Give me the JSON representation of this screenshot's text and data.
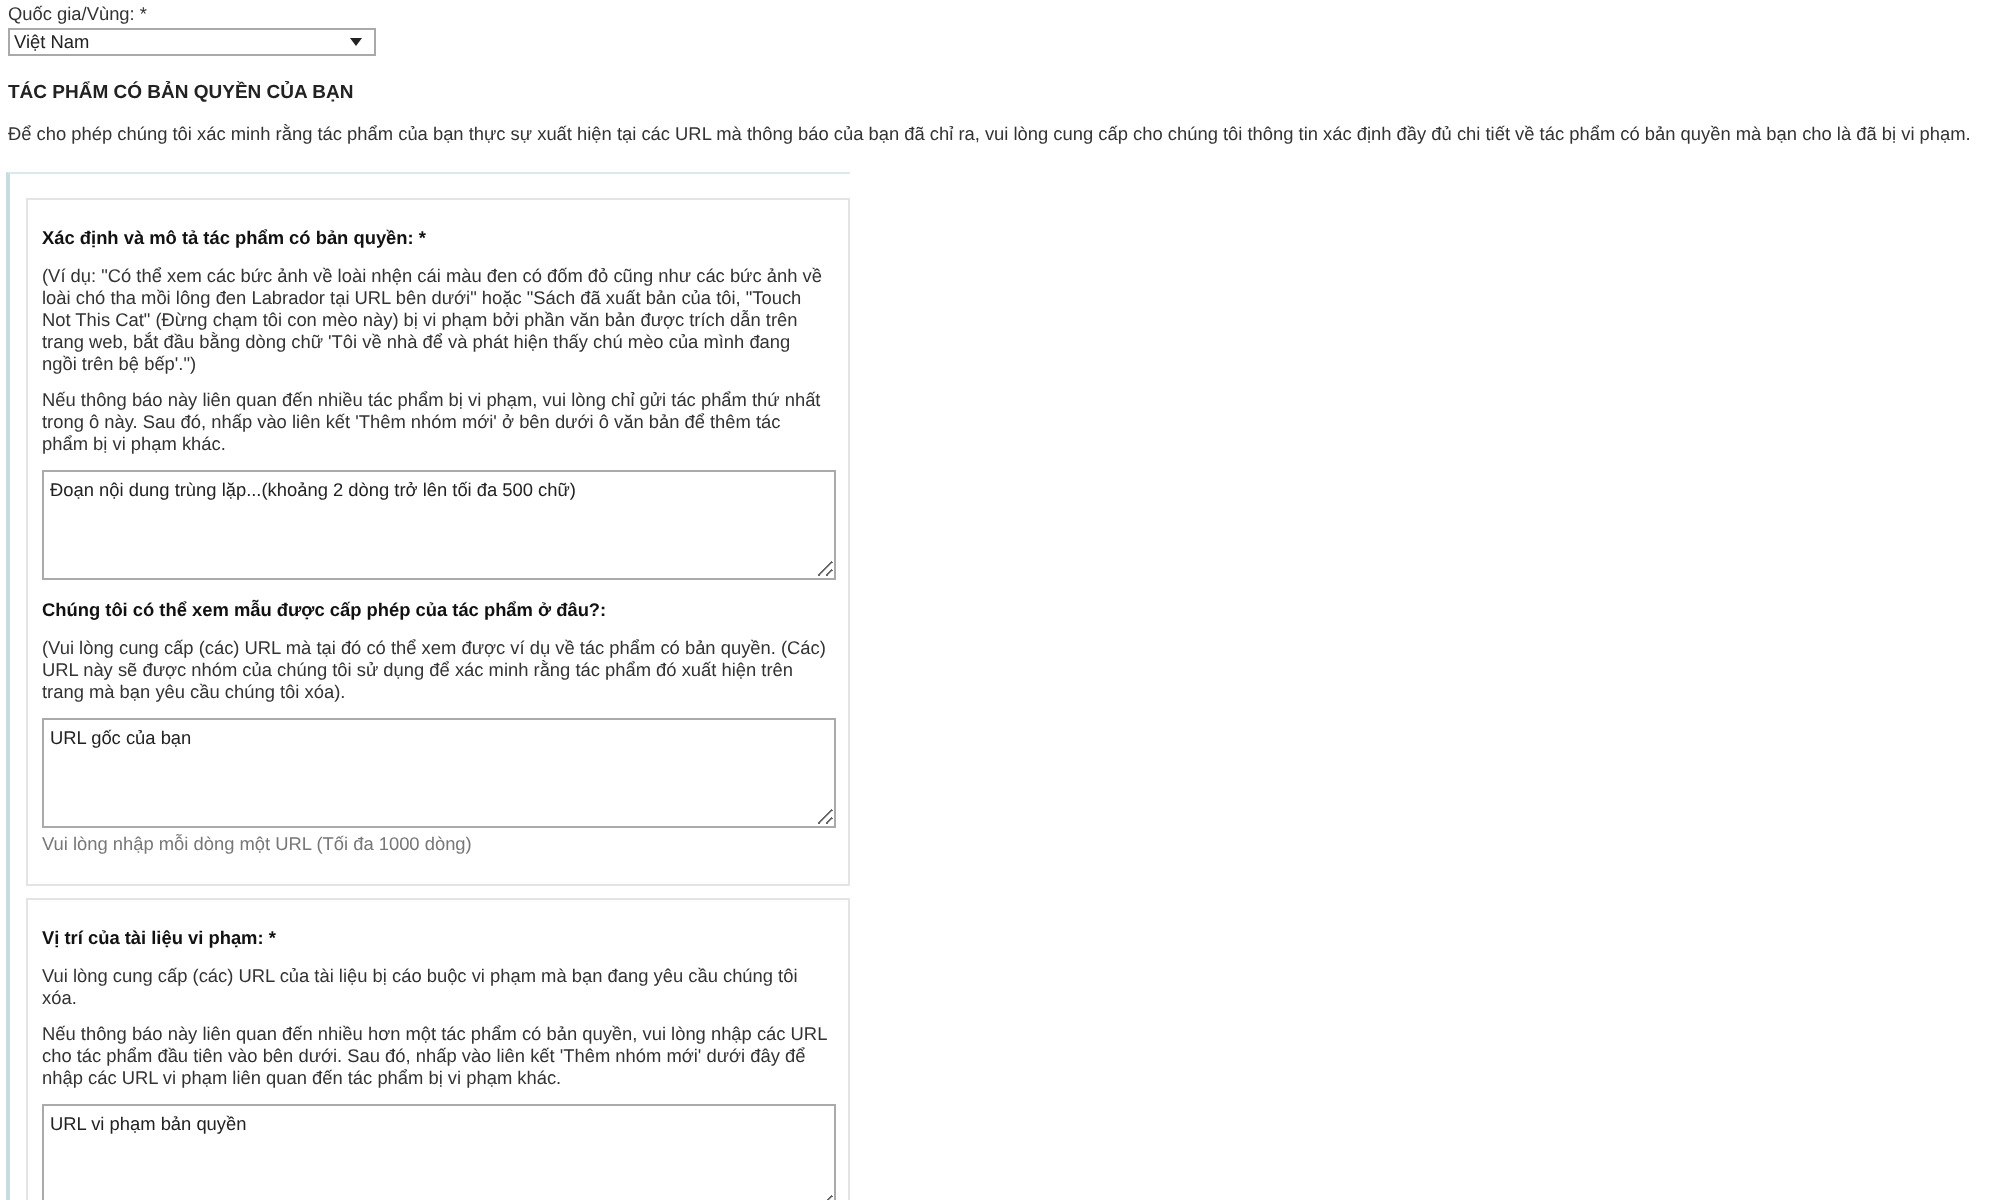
{
  "country_field": {
    "label": "Quốc gia/Vùng: *",
    "value": "Việt Nam"
  },
  "section": {
    "heading": "TÁC PHẨM CÓ BẢN QUYỀN CỦA BẠN",
    "intro": "Để cho phép chúng tôi xác minh rằng tác phẩm của bạn thực sự xuất hiện tại các URL mà thông báo của bạn đã chỉ ra, vui lòng cung cấp cho chúng tôi thông tin xác định đầy đủ chi tiết về tác phẩm có bản quyền mà bạn cho là đã bị vi phạm."
  },
  "groups": [
    {
      "questions": [
        {
          "label": "Xác định và mô tả tác phẩm có bản quyền: *",
          "paragraphs": [
            "(Ví dụ: \"Có thể xem các bức ảnh về loài nhện cái màu đen có đốm đỏ cũng như các bức ảnh về loài chó tha mồi lông đen Labrador tại URL bên dưới\" hoặc \"Sách đã xuất bản của tôi, \"Touch Not This Cat\" (Đừng chạm tôi con mèo này) bị vi phạm bởi phần văn bản được trích dẫn trên trang web, bắt đầu bằng dòng chữ 'Tôi về nhà để và phát hiện thấy chú mèo của mình đang ngồi trên bệ bếp'.\")",
            "Nếu thông báo này liên quan đến nhiều tác phẩm bị vi phạm, vui lòng chỉ gửi tác phẩm thứ nhất trong ô này. Sau đó, nhấp vào liên kết 'Thêm nhóm mới' ở bên dưới ô văn bản để thêm tác phẩm bị vi phạm khác."
          ],
          "value": "Đoạn nội dung trùng lặp...(khoảng 2 dòng trở lên tối đa 500 chữ)"
        },
        {
          "label": "Chúng tôi có thể xem mẫu được cấp phép của tác phẩm ở đâu?:",
          "paragraphs": [
            "(Vui lòng cung cấp (các) URL mà tại đó có thể xem được ví dụ về tác phẩm có bản quyền. (Các) URL này sẽ được nhóm của chúng tôi sử dụng để xác minh rằng tác phẩm đó xuất hiện trên trang mà bạn yêu cầu chúng tôi xóa)."
          ],
          "value": "URL gốc của bạn",
          "hint": "Vui lòng nhập mỗi dòng một URL (Tối đa 1000 dòng)"
        }
      ]
    },
    {
      "questions": [
        {
          "label": "Vị trí của tài liệu vi phạm: *",
          "paragraphs": [
            "Vui lòng cung cấp (các) URL của tài liệu bị cáo buộc vi phạm mà bạn đang yêu cầu chúng tôi xóa.",
            "Nếu thông báo này liên quan đến nhiều hơn một tác phẩm có bản quyền, vui lòng nhập các URL cho tác phẩm đầu tiên vào bên dưới. Sau đó, nhấp vào liên kết 'Thêm nhóm mới' dưới đây để nhập các URL vi phạm liên quan đến tác phẩm bị vi phạm khác."
          ],
          "value": "URL vi phạm bản quyền"
        }
      ]
    }
  ]
}
